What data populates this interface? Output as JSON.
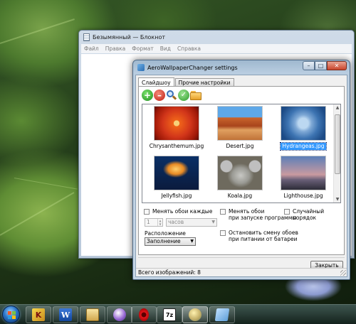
{
  "notepad": {
    "title": "Безымянный — Блокнот",
    "menu": [
      "Файл",
      "Правка",
      "Формат",
      "Вид",
      "Справка"
    ]
  },
  "dialog": {
    "title": "AeroWallpaperChanger settings",
    "window_buttons": {
      "minimize": "–",
      "maximize": "□",
      "close": "✕"
    },
    "tabs": [
      {
        "label": "Слайдшоу",
        "active": true
      },
      {
        "label": "Прочие настройки",
        "active": false
      }
    ],
    "toolbar": [
      {
        "name": "add",
        "icon": "plus-circle-icon"
      },
      {
        "name": "remove",
        "icon": "minus-circle-icon"
      },
      {
        "name": "search",
        "icon": "magnifier-icon"
      },
      {
        "name": "apply",
        "icon": "check-circle-icon"
      },
      {
        "name": "open-folder",
        "icon": "folder-icon"
      }
    ],
    "images": [
      {
        "file": "Chrysanthemum.jpg",
        "selected": false
      },
      {
        "file": "Desert.jpg",
        "selected": false
      },
      {
        "file": "Hydrangeas.jpg",
        "selected": true
      },
      {
        "file": "Jellyfish.jpg",
        "selected": false
      },
      {
        "file": "Koala.jpg",
        "selected": false
      },
      {
        "file": "Lighthouse.jpg",
        "selected": false
      }
    ],
    "options": {
      "change_every_label": "Менять обои каждые",
      "interval_value": "1",
      "interval_unit": "часов",
      "change_on_start_line1": "Менять обои",
      "change_on_start_line2": "при запуске программы",
      "random_order_label": "Случайный порядок",
      "position_label": "Расположение",
      "position_value": "Заполнение",
      "battery_line1": "Остановить смену обоев",
      "battery_line2": "при питании от батареи"
    },
    "close_button": "Закрыть",
    "status": "Всего изображений: 8"
  },
  "taskbar": {
    "items": [
      {
        "name": "k-app",
        "icon": "k-app-icon",
        "glyph": "K",
        "active": false
      },
      {
        "name": "word",
        "icon": "word-icon",
        "glyph": "W",
        "active": false
      },
      {
        "name": "explorer",
        "icon": "folder-icon",
        "glyph": "",
        "active": false
      },
      {
        "name": "media-player",
        "icon": "media-icon",
        "glyph": "",
        "active": false
      },
      {
        "name": "opera",
        "icon": "opera-icon",
        "glyph": "",
        "active": false
      },
      {
        "name": "7zip",
        "icon": "7zip-icon",
        "glyph": "7z",
        "active": false
      },
      {
        "name": "aero-wallpaper",
        "icon": "aero-icon",
        "glyph": "",
        "active": true
      },
      {
        "name": "notepad",
        "icon": "notepad-icon",
        "glyph": "",
        "active": false
      }
    ]
  }
}
